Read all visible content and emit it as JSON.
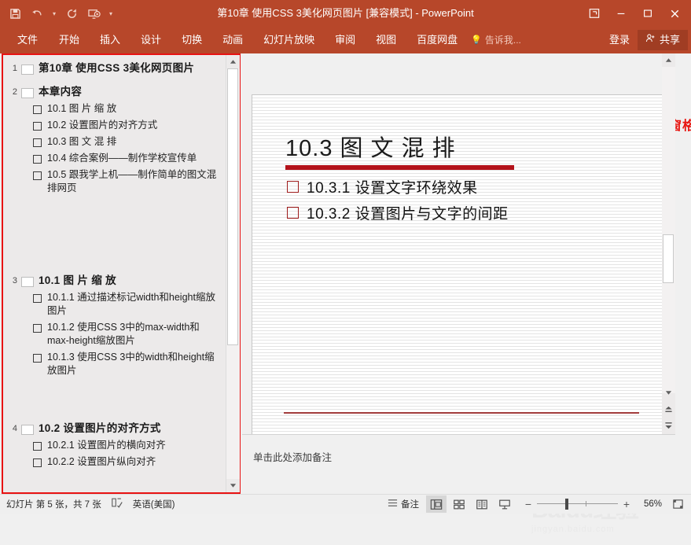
{
  "window": {
    "title": "第10章  使用CSS 3美化网页图片 [兼容模式] - PowerPoint",
    "quick_access": [
      {
        "name": "save-icon",
        "label": "保存"
      },
      {
        "name": "undo-icon",
        "label": "撤消"
      },
      {
        "name": "redo-icon",
        "label": "恢复"
      },
      {
        "name": "start-slideshow-icon",
        "label": "从头开始"
      },
      {
        "name": "customize-qat-icon",
        "label": "自定义快速访问工具栏"
      }
    ],
    "controls": [
      {
        "name": "ribbon-display-options-icon",
        "label": "功能区显示选项"
      },
      {
        "name": "minimize-icon",
        "label": "最小化"
      },
      {
        "name": "maximize-icon",
        "label": "最大化"
      },
      {
        "name": "close-icon",
        "label": "关闭"
      }
    ]
  },
  "ribbon": {
    "tabs": [
      {
        "label": "文件"
      },
      {
        "label": "开始"
      },
      {
        "label": "插入"
      },
      {
        "label": "设计"
      },
      {
        "label": "切换"
      },
      {
        "label": "动画"
      },
      {
        "label": "幻灯片放映"
      },
      {
        "label": "审阅"
      },
      {
        "label": "视图"
      },
      {
        "label": "百度网盘"
      }
    ],
    "tell_me": "告诉我...",
    "sign_in": "登录",
    "share": "共享"
  },
  "outline": {
    "slides": [
      {
        "number": "1",
        "title": "第10章  使用CSS 3美化网页图片",
        "bullets": []
      },
      {
        "number": "2",
        "title": "本章内容",
        "bullets": [
          "10.1  图 片 缩 放",
          "10.2  设置图片的对齐方式",
          "10.3  图 文 混 排",
          "10.4  综合案例——制作学校宣传单",
          "10.5  跟我学上机——制作简单的图文混排网页"
        ]
      },
      {
        "number": "3",
        "title": "10.1  图 片 缩 放",
        "bullets": [
          "10.1.1  通过描述标记width和height缩放图片",
          "10.1.2  使用CSS 3中的max-width和max-height缩放图片",
          "10.1.3  使用CSS 3中的width和height缩放图片"
        ]
      },
      {
        "number": "4",
        "title": "10.2  设置图片的对齐方式",
        "bullets": [
          "10.2.1  设置图片的横向对齐",
          "10.2.2  设置图片纵向对齐"
        ]
      }
    ]
  },
  "annotation": {
    "text": "大纲视图的大纲窗格"
  },
  "slide": {
    "title": "10.3  图 文 混 排",
    "bullets": [
      "10.3.1  设置文字环绕效果",
      "10.3.2  设置图片与文字的间距"
    ]
  },
  "notes": {
    "placeholder": "单击此处添加备注"
  },
  "watermark": {
    "main": "Baidu经验",
    "sub": "jingyan.baidu.com"
  },
  "status": {
    "slide_count": "幻灯片 第 5 张，共 7 张",
    "language": "英语(美国)",
    "notes_label": "备注",
    "views": [
      {
        "name": "normal-view-icon",
        "label": "普通视图",
        "active": true
      },
      {
        "name": "slide-sorter-view-icon",
        "label": "幻灯片浏览",
        "active": false
      },
      {
        "name": "reading-view-icon",
        "label": "阅读视图",
        "active": false
      },
      {
        "name": "slideshow-view-icon",
        "label": "幻灯片放映",
        "active": false
      }
    ],
    "zoom_out": "−",
    "zoom_in": "+",
    "zoom_percent": "56%",
    "fit_label": "使幻灯片适应当前窗口"
  },
  "colors": {
    "titlebar": "#b7472a",
    "annotation": "#e8140f",
    "slide_rule": "#b3121a",
    "outline_border": "#e81313"
  }
}
